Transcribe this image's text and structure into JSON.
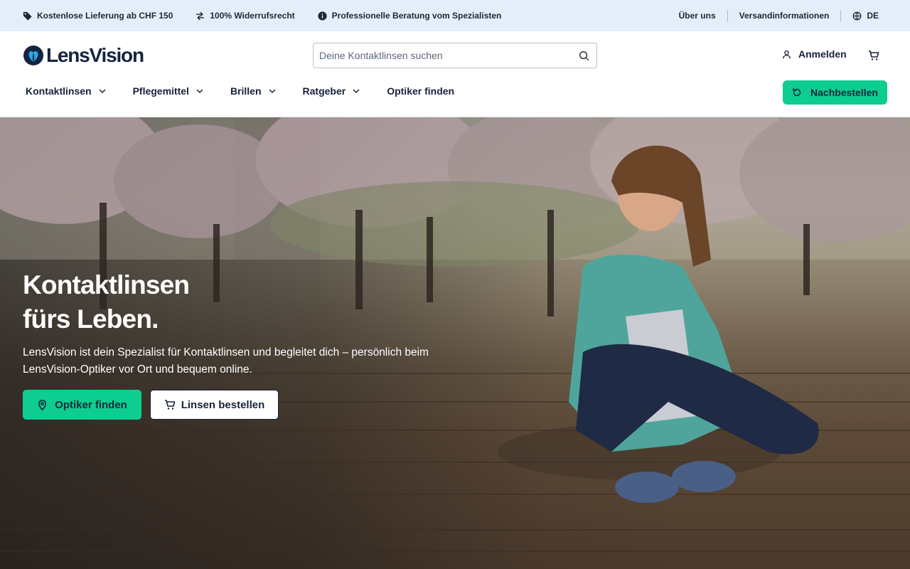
{
  "infobar": {
    "usps": [
      {
        "icon": "tag-icon",
        "label": "Kostenlose Lieferung ab CHF 150"
      },
      {
        "icon": "swap-arrows-icon",
        "label": "100% Widerrufsrecht"
      },
      {
        "icon": "info-icon",
        "label": "Professionelle Beratung vom Spezialisten"
      }
    ],
    "links": {
      "about": "Über uns",
      "shipping": "Versandinformationen"
    },
    "language": "DE"
  },
  "header": {
    "logo_text": "LensVision",
    "search_placeholder": "Deine Kontaktlinsen suchen",
    "login_label": "Anmelden"
  },
  "nav": {
    "items": [
      {
        "label": "Kontaktlinsen",
        "has_dropdown": true
      },
      {
        "label": "Pflegemittel",
        "has_dropdown": true
      },
      {
        "label": "Brillen",
        "has_dropdown": true
      },
      {
        "label": "Ratgeber",
        "has_dropdown": true
      },
      {
        "label": "Optiker finden",
        "has_dropdown": false
      }
    ],
    "reorder_label": "Nachbestellen"
  },
  "hero": {
    "title_line1": "Kontaktlinsen",
    "title_line2": "fürs Leben.",
    "text": "LensVision ist dein Spezialist für Kontaktlinsen und begleitet dich – persönlich beim LensVision-Optiker vor Ort und bequem online.",
    "primary_button": "Optiker finden",
    "secondary_button": "Linsen bestellen"
  },
  "colors": {
    "accent": "#0ecd90",
    "infobar_bg": "#e4eefb",
    "brand_dark": "#14233f"
  }
}
